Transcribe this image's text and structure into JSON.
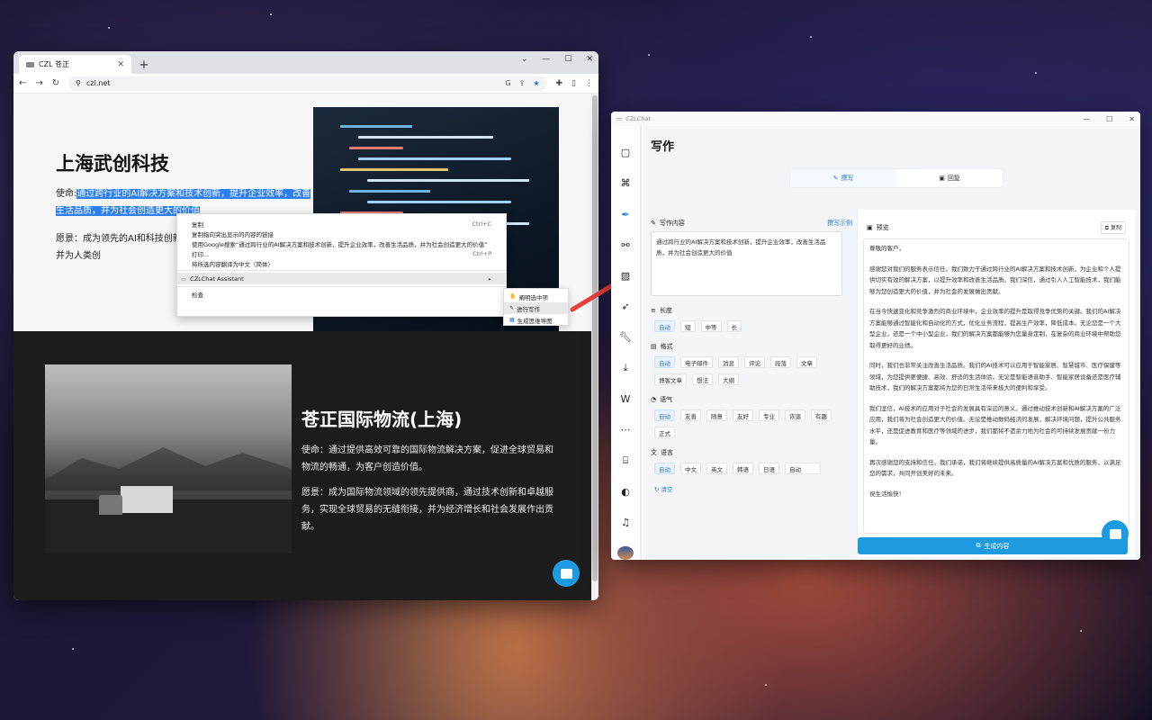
{
  "browser": {
    "tab_title": "CZL 苍正",
    "url": "czl.net",
    "window_controls": [
      "⌄",
      "—",
      "☐",
      "✕"
    ]
  },
  "page": {
    "section1": {
      "title": "上海武创科技",
      "mission_prefix": "使命:",
      "mission_highlight": "通过跨行业的AI解决方案和技术创新，提升企业效率，改善生活品质，并为社会创造更大的价值",
      "vision": "愿景：成为领先的AI和科技创新提供商，改变行业、改善生活，并为人类创"
    },
    "section2": {
      "title": "苍正国际物流(上海)",
      "mission": "使命：通过提供高效可靠的国际物流解决方案，促进全球贸易和物流的畅通，为客户创造价值。",
      "vision": "愿景：成为国际物流领域的领先提供商，通过技术创新和卓越服务，实现全球贸易的无缝衔接，并为经济增长和社会发展作出贡献。"
    }
  },
  "context_menu": {
    "items": [
      {
        "label": "复制",
        "shortcut": "Ctrl+C"
      },
      {
        "label": "复制指向突出显示的内容的链接",
        "shortcut": ""
      },
      {
        "label": "使用Google搜索“通过跨行业的AI解决方案和技术创新，提升企业效率，改善生活品质，并为社会创造更大的价值”",
        "shortcut": ""
      },
      {
        "label": "打印...",
        "shortcut": "Ctrl+P"
      },
      {
        "label": "将所选内容翻译为中文（简体）",
        "shortcut": ""
      }
    ],
    "extension_item": "CZLChat Assistant",
    "inspect": "检查",
    "submenu": [
      "阐明选中项",
      "进行写作",
      "生成思维导图"
    ]
  },
  "app": {
    "window_title": "CZLChat",
    "page_title": "写作",
    "tabs": [
      "撰写",
      "回复"
    ],
    "content_label": "写作内容",
    "example_link": "撰写示例",
    "content_value": "通过跨行业的AI解决方案和技术创新，提升企业效率，改善生活品质，并为社会创造更大的价值",
    "length_label": "长度",
    "length_options": [
      "自动",
      "短",
      "中等",
      "长"
    ],
    "format_label": "格式",
    "format_options": [
      "自动",
      "电子邮件",
      "消息",
      "评论",
      "段落",
      "文章",
      "博客文章",
      "想法",
      "大纲"
    ],
    "tone_label": "语气",
    "tone_options": [
      "自动",
      "友善",
      "随意",
      "友好",
      "专业",
      "诙谐",
      "有趣",
      "正式"
    ],
    "language_label": "语言",
    "language_options": [
      "自动",
      "中文",
      "英文",
      "韩语",
      "日语",
      "自动"
    ],
    "reset_label": "清空",
    "preview_label": "预览",
    "copy_label": "复制",
    "preview_paragraphs": [
      "尊敬的客户，",
      "感谢您对我们的服务表示信任。我们致力于通过跨行业的AI解决方案和技术创新，为企业和个人提供切实有效的解决方案，以提升效率和改善生活品质。我们深信，通过引入人工智能技术，我们能够为您创造更大的价值，并为社会的发展做出贡献。",
      "在当今快速变化和竞争激烈的商业环境中，企业效率的提升是取得竞争优势的关键。我们的AI解决方案能够通过智能化和自动化的方式，优化业务流程，提高生产效率，降低成本。无论您是一个大型企业，还是一个中小型企业，我们的解决方案都能够为您量身定制，在复杂的商业环境中帮助您取得更好的业绩。",
      "同时，我们也非常关注改善生活品质。我们的AI技术可以应用于智能家居、智慧城市、医疗保健等领域，为您提供更便捷、高效、舒适的生活体验。无论是智能语音助手、智能家居设备还是医疗辅助技术，我们的解决方案都将为您的日常生活带来极大的便利和享受。",
      "我们坚信，AI技术的应用对于社会的发展具有深远的意义。通过推动技术创新和AI解决方案的广泛应用，我们将为社会创造更大的价值。无论是推动数码经济的发展，解决环境问题，提升公共服务水平，还是促进教育和医疗等领域的进步，我们都将不遗余力地为社会的可持续发展贡献一份力量。",
      "再次感谢您的支持和信任。我们承诺，我们将继续提供高质量的AI解决方案和优质的服务，以满足您的需求，共同开创美好的未来。",
      "祝生活愉快！"
    ],
    "generate_button": "生成内容"
  }
}
